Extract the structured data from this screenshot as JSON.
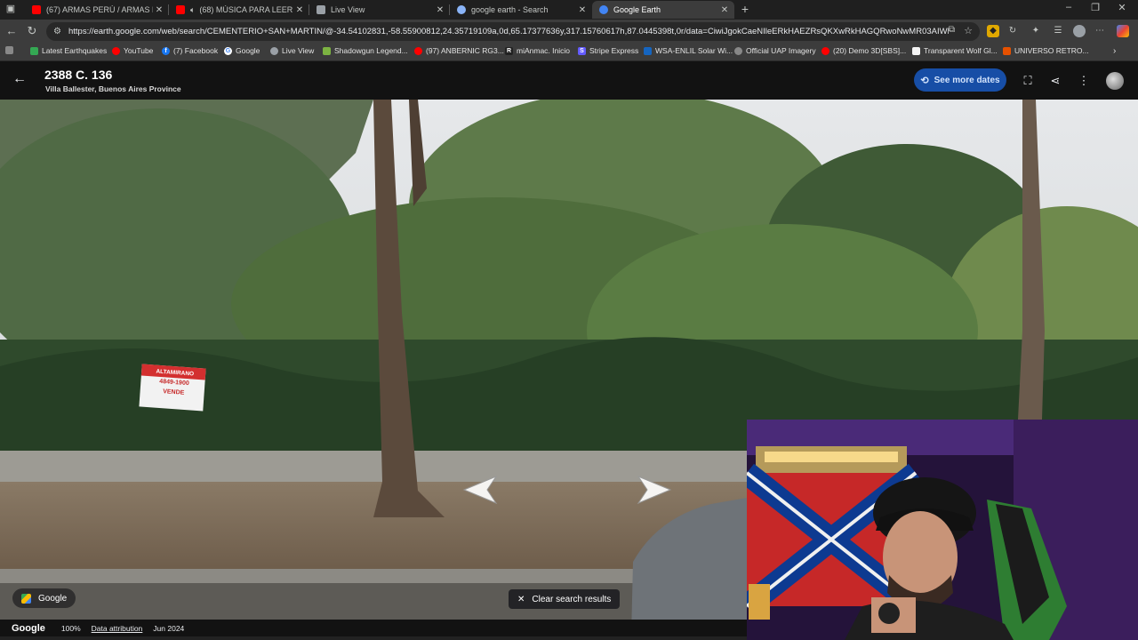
{
  "tabs": [
    {
      "title": "(67) ARMAS PERÚ / ARMAS PARA",
      "color": "#ff0000"
    },
    {
      "title": "(68) MÚSICA PARA LEER TE",
      "color": "#ff0000"
    },
    {
      "title": "Live View",
      "color": "#9aa0a6"
    },
    {
      "title": "google earth - Search",
      "color": "#8ab4f8"
    },
    {
      "title": "Google Earth",
      "color": "#4285f4"
    }
  ],
  "address": {
    "url": "https://earth.google.com/web/search/CEMENTERIO+SAN+MARTIN/@-34.54102831,-58.55900812,24.35719109a,0d,65.17377636y,317.15760617h,87.0445398t,0r/data=CiwiJgokCaeNIleERkHAEZRsQKXwRkHAGQRwoNwMR03AIWkfdUyO..."
  },
  "bookmarks": [
    {
      "label": "Latest Earthquakes",
      "color": "#34a853"
    },
    {
      "label": "YouTube",
      "color": "#ff0000"
    },
    {
      "label": "(7) Facebook",
      "color": "#1877f2"
    },
    {
      "label": "Google",
      "color": "#4285f4"
    },
    {
      "label": "Live View",
      "color": "#9aa0a6"
    },
    {
      "label": "Shadowgun Legend...",
      "color": "#7cb342"
    },
    {
      "label": "(97) ANBERNIC RG3...",
      "color": "#ff0000"
    },
    {
      "label": "miAnmac. Inicio",
      "color": "#222222"
    },
    {
      "label": "Stripe Express",
      "color": "#635bff"
    },
    {
      "label": "WSA-ENLIL Solar Wi...",
      "color": "#1565c0"
    },
    {
      "label": "Official UAP Imagery",
      "color": "#888888"
    },
    {
      "label": "(20) Demo 3D[SBS]...",
      "color": "#ff0000"
    },
    {
      "label": "Transparent Wolf Gl...",
      "color": "#f4f4f4"
    },
    {
      "label": "UNIVERSO RETRO...",
      "color": "#e65100"
    }
  ],
  "earth": {
    "title": "2388 C. 136",
    "subtitle": "Villa Ballester, Buenos Aires Province",
    "see_more_dates": "See more dates",
    "clear_search": "Clear search results",
    "google_badge": "Google"
  },
  "sign": {
    "line1": "ALTAMIRANO",
    "line2": "4849-1900",
    "line3": "VENDE"
  },
  "status": {
    "logo": "Google",
    "zoom": "100%",
    "attribution": "Data attribution",
    "date": "Jun 2024"
  },
  "colors": {
    "accent": "#174ea6",
    "chrome_dark": "#1f1f1f",
    "chrome_mid": "#3c3c3c"
  }
}
